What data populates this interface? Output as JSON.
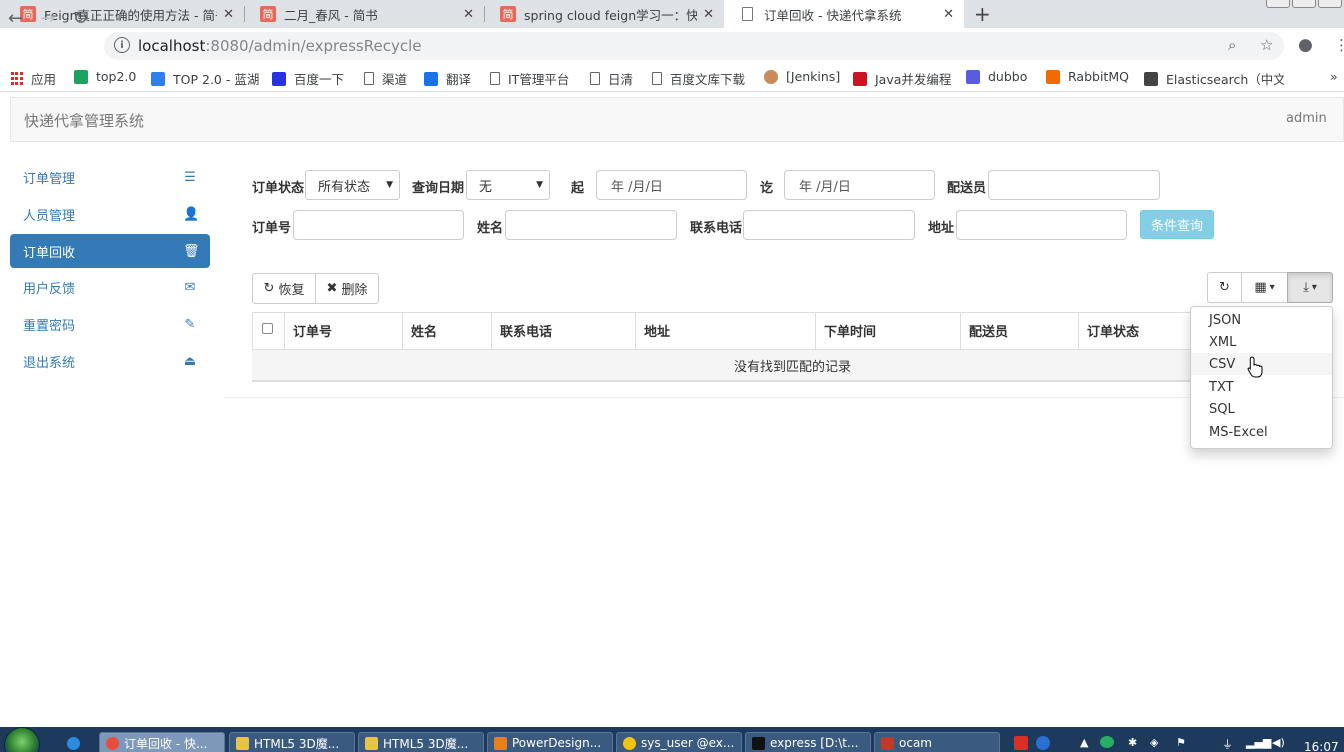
{
  "browser": {
    "tabs": [
      {
        "title": "Feign真正正确的使用方法 - 简书",
        "favicon": "简"
      },
      {
        "title": "二月_春风 - 简书",
        "favicon": "简"
      },
      {
        "title": "spring cloud feign学习一：快速",
        "favicon": "简"
      },
      {
        "title": "订单回收 - 快递代拿系统",
        "favicon": ""
      }
    ],
    "close_glyph": "✕",
    "new_tab_glyph": "+",
    "url_host": "localhost",
    "url_path": ":8080/admin/expressRecycle",
    "info_glyph": "i",
    "bookmarks": [
      {
        "label": "应用",
        "icon": "apps-grid-icon",
        "color": "#d93025"
      },
      {
        "label": "top2.0",
        "icon": "top-icon",
        "color": "#1aa260"
      },
      {
        "label": "TOP 2.0 - 蓝湖",
        "icon": "lanhu-icon",
        "color": "#2f80ed"
      },
      {
        "label": "百度一下",
        "icon": "baidu-icon",
        "color": "#2932e1"
      },
      {
        "label": "渠道",
        "icon": "page-icon",
        "color": ""
      },
      {
        "label": "翻译",
        "icon": "translate-icon",
        "color": "#1a73e8"
      },
      {
        "label": "IT管理平台",
        "icon": "page-icon",
        "color": ""
      },
      {
        "label": "日清",
        "icon": "page-icon",
        "color": ""
      },
      {
        "label": "百度文库下载",
        "icon": "page-icon",
        "color": ""
      },
      {
        "label": "[Jenkins]",
        "icon": "jenkins-icon",
        "color": "#c98b5a"
      },
      {
        "label": "Java并发编程",
        "icon": "csdn-icon",
        "color": "#c81623"
      },
      {
        "label": "dubbo",
        "icon": "dubbo-icon",
        "color": "#5b5be0"
      },
      {
        "label": "RabbitMQ",
        "icon": "rabbitmq-icon",
        "color": "#f26b00"
      },
      {
        "label": "Elasticsearch（中文",
        "icon": "book-icon",
        "color": "#444444"
      }
    ],
    "more_glyph": "»"
  },
  "app": {
    "brand": "快递代拿管理系统",
    "user": "admin",
    "sidebar": [
      {
        "label": "订单管理",
        "icon": "list-icon",
        "glyph": "☰"
      },
      {
        "label": "人员管理",
        "icon": "user-icon",
        "glyph": "👤"
      },
      {
        "label": "订单回收",
        "icon": "trash-icon",
        "glyph": "🗑"
      },
      {
        "label": "用户反馈",
        "icon": "envelope-icon",
        "glyph": "✉"
      },
      {
        "label": "重置密码",
        "icon": "pencil-icon",
        "glyph": "✎"
      },
      {
        "label": "退出系统",
        "icon": "logout-icon",
        "glyph": "⏏"
      }
    ],
    "filters": {
      "status_label": "订单状态",
      "status_value": "所有状态",
      "date_label": "查询日期",
      "date_value": "无",
      "from_label": "起",
      "from_placeholder": "年 /月/日",
      "to_label": "讫",
      "to_placeholder": "年 /月/日",
      "courier_label": "配送员",
      "order_no_label": "订单号",
      "name_label": "姓名",
      "phone_label": "联系电话",
      "address_label": "地址",
      "query_button": "条件查询"
    },
    "toolbar": {
      "restore": "恢复",
      "delete": "删除",
      "refresh_glyph": "↻",
      "columns_glyph": "▦",
      "export_glyph": "⤓",
      "caret_glyph": "▾"
    },
    "table": {
      "columns": [
        "订单号",
        "姓名",
        "联系电话",
        "地址",
        "下单时间",
        "配送员",
        "订单状态"
      ],
      "empty_message": "没有找到匹配的记录"
    },
    "export_menu": [
      "JSON",
      "XML",
      "CSV",
      "TXT",
      "SQL",
      "MS-Excel"
    ],
    "export_hover_index": 2
  },
  "taskbar": {
    "tasks": [
      {
        "label": "订单回收 - 快...",
        "color": "#e74c3c"
      },
      {
        "label": "HTML5 3D魔...",
        "color": "#e8c34a"
      },
      {
        "label": "HTML5 3D魔...",
        "color": "#e8c34a"
      },
      {
        "label": "PowerDesign...",
        "color": "#e67e22"
      },
      {
        "label": "sys_user @ex...",
        "color": "#f1c40f"
      },
      {
        "label": "express [D:\\t...",
        "color": "#111111"
      },
      {
        "label": "ocam",
        "color": "#c0392b"
      }
    ],
    "clock": "16:07"
  }
}
